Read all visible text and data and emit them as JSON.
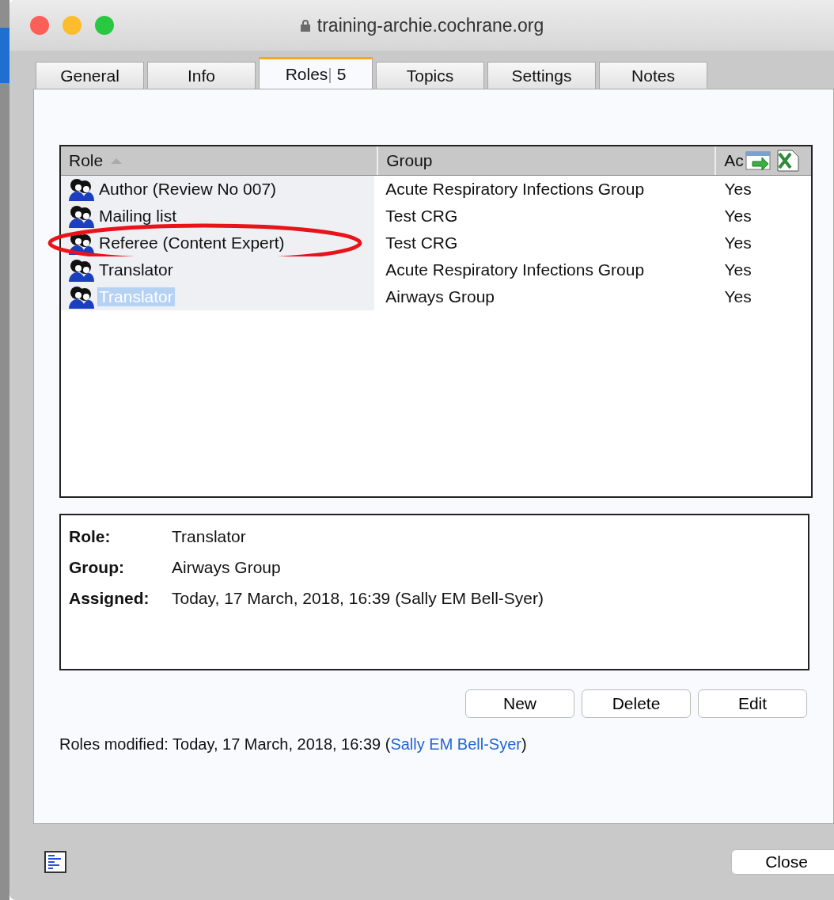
{
  "window": {
    "title": "training-archie.cochrane.org"
  },
  "tabs": [
    {
      "label": "General",
      "selected": false
    },
    {
      "label": "Info",
      "selected": false
    },
    {
      "label": "Roles",
      "separator": "|",
      "count": "5",
      "selected": true
    },
    {
      "label": "Topics",
      "selected": false
    },
    {
      "label": "Settings",
      "selected": false
    },
    {
      "label": "Notes",
      "selected": false
    }
  ],
  "table": {
    "columns": [
      {
        "label": "Role",
        "sorted": true
      },
      {
        "label": "Group"
      },
      {
        "label": "Ac"
      }
    ],
    "rows": [
      {
        "role": "Author (Review No 007)",
        "group": "Acute Respiratory Infections Group",
        "active": "Yes",
        "selected": false,
        "circled": false
      },
      {
        "role": "Mailing list",
        "group": "Test CRG",
        "active": "Yes",
        "selected": false,
        "circled": false
      },
      {
        "role": "Referee (Content Expert)",
        "group": "Test CRG",
        "active": "Yes",
        "selected": false,
        "circled": true
      },
      {
        "role": "Translator",
        "group": "Acute Respiratory Infections Group",
        "active": "Yes",
        "selected": false,
        "circled": false
      },
      {
        "role": "Translator",
        "group": "Airways Group",
        "active": "Yes",
        "selected": true,
        "circled": false
      }
    ]
  },
  "details": [
    {
      "label": "Role:",
      "value": "Translator"
    },
    {
      "label": "Group:",
      "value": "Airways Group"
    },
    {
      "label": "Assigned:",
      "value": "Today, 17 March, 2018, 16:39 (Sally EM Bell-Syer)"
    }
  ],
  "buttons": [
    "New",
    "Delete",
    "Edit"
  ],
  "modified": {
    "text": "Roles modified: Today, 17 March, 2018, 16:39 (",
    "link": "Sally EM Bell-Syer",
    "end": ")"
  },
  "close_button": "Close"
}
